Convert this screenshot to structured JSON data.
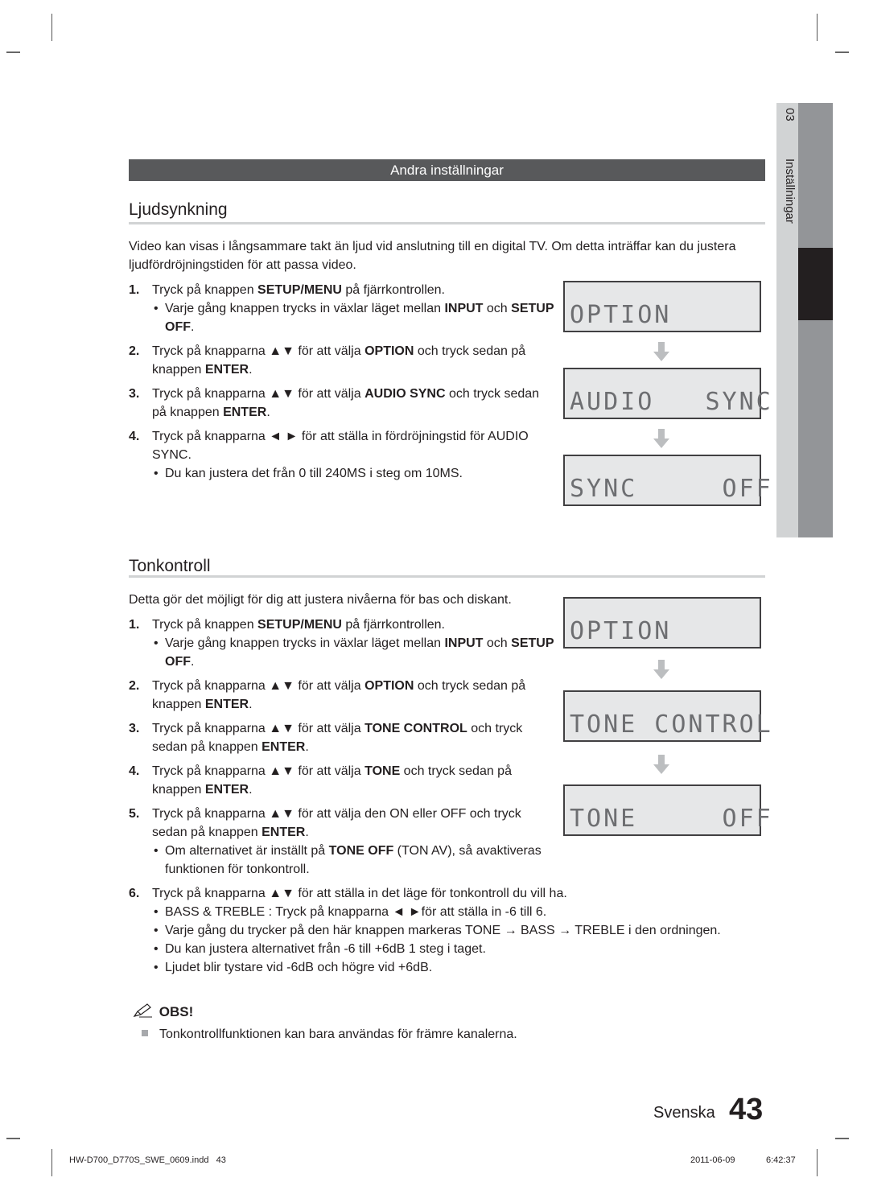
{
  "section_bar": "Andra inställningar",
  "side_tab": {
    "chapter": "03",
    "label": "Inställningar"
  },
  "ljud": {
    "heading": "Ljudsynkning",
    "intro": "Video kan visas i långsammare takt än ljud vid anslutning till en digital TV. Om detta inträffar kan du justera ljudfördröjningstiden för att passa video.",
    "steps": [
      {
        "num": "1.",
        "parts": [
          [
            "Tryck på knappen ",
            false
          ],
          [
            "SETUP/MENU",
            true
          ],
          [
            " på fjärrkontrollen.",
            false
          ]
        ],
        "bullets": [
          [
            [
              "Varje gång knappen trycks in växlar läget mellan ",
              false
            ],
            [
              "INPUT",
              true
            ],
            [
              " och ",
              false
            ],
            [
              "SETUP OFF",
              true
            ],
            [
              ".",
              false
            ]
          ]
        ]
      },
      {
        "num": "2.",
        "parts": [
          [
            "Tryck på knapparna ▲▼ för att välja ",
            false
          ],
          [
            "OPTION",
            true
          ],
          [
            " och tryck sedan på knappen ",
            false
          ],
          [
            "ENTER",
            true
          ],
          [
            ".",
            false
          ]
        ],
        "bullets": []
      },
      {
        "num": "3.",
        "parts": [
          [
            "Tryck på knapparna ▲▼ för att välja ",
            false
          ],
          [
            "AUDIO SYNC",
            true
          ],
          [
            " och tryck sedan på knappen ",
            false
          ],
          [
            "ENTER",
            true
          ],
          [
            ".",
            false
          ]
        ],
        "bullets": []
      },
      {
        "num": "4.",
        "parts": [
          [
            "Tryck på knapparna ◄ ► för att ställa in fördröjningstid för AUDIO SYNC.",
            false
          ]
        ],
        "bullets": [
          [
            [
              "Du kan justera det från 0 till 240MS i steg om 10MS.",
              false
            ]
          ]
        ]
      }
    ],
    "displays": [
      "OPTION",
      "AUDIO   SYNC",
      "SYNC     OFF"
    ]
  },
  "ton": {
    "heading": "Tonkontroll",
    "intro": "Detta gör det möjligt för dig att justera nivåerna för bas och diskant.",
    "steps": [
      {
        "num": "1.",
        "parts": [
          [
            "Tryck på knappen ",
            false
          ],
          [
            "SETUP/MENU",
            true
          ],
          [
            " på fjärrkontrollen.",
            false
          ]
        ],
        "bullets": [
          [
            [
              "Varje gång knappen trycks in växlar läget mellan ",
              false
            ],
            [
              "INPUT",
              true
            ],
            [
              " och ",
              false
            ],
            [
              "SETUP OFF",
              true
            ],
            [
              ".",
              false
            ]
          ]
        ]
      },
      {
        "num": "2.",
        "parts": [
          [
            "Tryck på knapparna ▲▼ för att välja ",
            false
          ],
          [
            "OPTION",
            true
          ],
          [
            " och tryck sedan på knappen ",
            false
          ],
          [
            "ENTER",
            true
          ],
          [
            ".",
            false
          ]
        ],
        "bullets": []
      },
      {
        "num": "3.",
        "parts": [
          [
            "Tryck på knapparna ▲▼ för att välja ",
            false
          ],
          [
            "TONE CONTROL",
            true
          ],
          [
            " och tryck sedan på knappen ",
            false
          ],
          [
            "ENTER",
            true
          ],
          [
            ".",
            false
          ]
        ],
        "bullets": []
      },
      {
        "num": "4.",
        "parts": [
          [
            "Tryck på knapparna ▲▼ för att välja ",
            false
          ],
          [
            "TONE",
            true
          ],
          [
            " och tryck sedan på knappen ",
            false
          ],
          [
            "ENTER",
            true
          ],
          [
            ".",
            false
          ]
        ],
        "bullets": []
      },
      {
        "num": "5.",
        "parts": [
          [
            "Tryck på knapparna ▲▼ för att välja den ON eller OFF och tryck sedan på knappen ",
            false
          ],
          [
            "ENTER",
            true
          ],
          [
            ".",
            false
          ]
        ],
        "bullets": [
          [
            [
              "Om alternativet är inställt på ",
              false
            ],
            [
              "TONE OFF",
              true
            ],
            [
              " (TON AV), så avaktiveras funktionen för tonkontroll.",
              false
            ]
          ]
        ]
      }
    ],
    "step6": {
      "num": "6.",
      "parts": [
        [
          "Tryck på knapparna ▲▼ för att ställa in det läge för tonkontroll du vill ha.",
          false
        ]
      ],
      "bullets": [
        [
          [
            "BASS & TREBLE : Tryck på knapparna ◄ ►för att ställa in -6 till 6.",
            false
          ]
        ],
        [
          [
            "Varje gång du trycker på den här knappen markeras TONE → BASS → TREBLE i den ordningen.",
            false
          ]
        ],
        [
          [
            "Du kan justera alternativet från -6 till +6dB 1 steg i taget.",
            false
          ]
        ],
        [
          [
            "Ljudet blir tystare vid -6dB och högre vid +6dB.",
            false
          ]
        ]
      ]
    },
    "displays": [
      "OPTION",
      "TONE CONTROL",
      "TONE     OFF"
    ]
  },
  "obs": {
    "label": "OBS!",
    "note": "Tonkontrollfunktionen kan bara användas för främre kanalerna."
  },
  "page": {
    "language": "Svenska",
    "number": "43"
  },
  "footer": {
    "file": "HW-D700_D770S_SWE_0609.indd   43",
    "date": "2011-06-09",
    "time": "6:42:37"
  }
}
